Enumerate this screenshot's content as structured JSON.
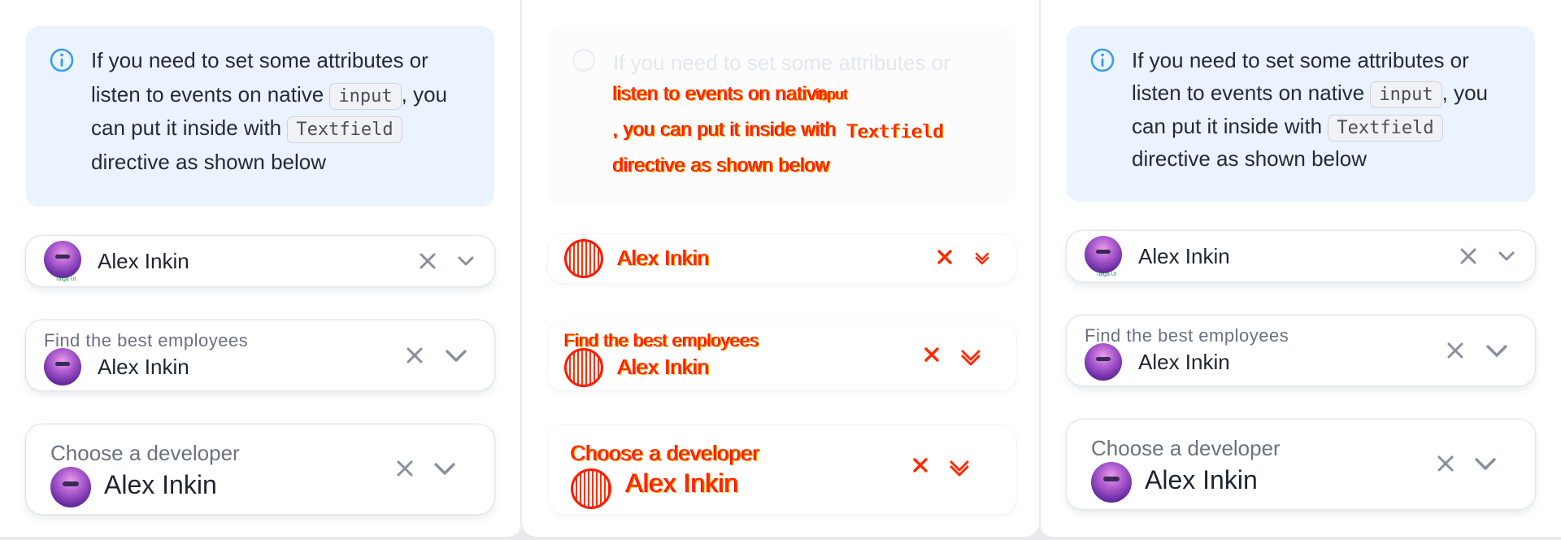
{
  "info_text": {
    "line1": "If you need to set some attributes or",
    "part_a": "listen to events on native ",
    "code_input": "input",
    "part_b": ", you can put it inside with ",
    "code_textfield": "Textfield",
    "part_c": " directive as shown below"
  },
  "user": {
    "name": "Alex Inkin",
    "avatar_caption": "Taiga UI"
  },
  "fields": {
    "small_label": "Find the best employees",
    "large_label": "Choose a developer"
  },
  "icons": {
    "info": "info-icon",
    "clear": "close-icon",
    "expand": "chevron-down-icon"
  },
  "colors": {
    "info_bg": "#eaf3fe",
    "info_icon": "#3b9bf3",
    "ghost_red": "#ff2a00",
    "ghost_orange": "#ffb400"
  }
}
